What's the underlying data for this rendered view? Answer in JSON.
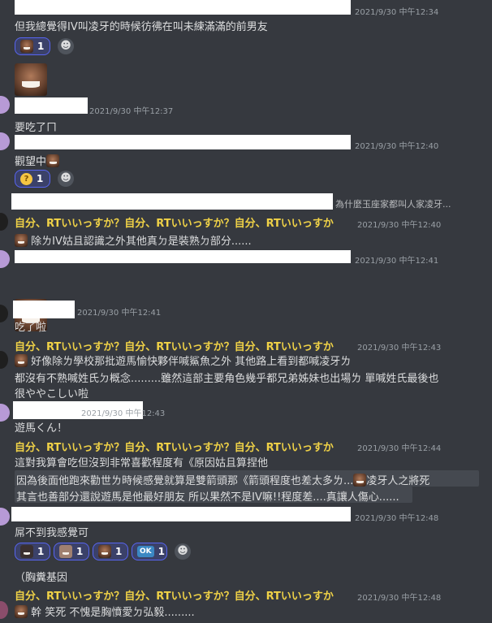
{
  "messages": {
    "m1": {
      "timestamp": "2021/9/30 中午12:34",
      "text": "但我總覺得IV叫凌牙的時候彷彿在叫未練滿滿的前男友",
      "reaction_count": "1"
    },
    "m2": {
      "timestamp": "2021/9/30 中午12:37",
      "text": "要吃了ㄇ"
    },
    "m3": {
      "timestamp": "2021/9/30 中午12:40",
      "text": "觀望中",
      "reaction_count": "1"
    },
    "reply1": {
      "reply_preview": "為什麼玉座家都叫人家凌牙...",
      "author": "自分、RTいいっすか？自分、RTいいっすか？自分、RTいいっすか",
      "timestamp": "2021/9/30 中午12:40",
      "text": "除ㄌIV姑且認識之外其他真ㄉ是裝熟ㄉ部分......"
    },
    "m5": {
      "timestamp": "2021/9/30 中午12:41"
    },
    "m6": {
      "timestamp": "2021/9/30 中午12:41",
      "text": "吃了啦"
    },
    "reply2": {
      "author": "自分、RTいいっすか？自分、RTいいっすか？自分、RTいいっすか",
      "timestamp": "2021/9/30 中午12:43",
      "line1": "好像除ㄌ學校那批遊馬愉快夥伴喊鯊魚之外 其他路上看到都喊凌牙ㄌ",
      "line2": "都沒有不熟喊姓氏ㄉ概念.........雖然這部主要角色幾乎都兄弟姊妹也出場ㄌ 單喊姓氏最後也",
      "line3": "很ややこしい啦"
    },
    "m8": {
      "timestamp": "2021/9/30 中午12:43",
      "text": "遊馬くん！"
    },
    "reply3": {
      "author": "自分、RTいいっすか？自分、RTいいっすか？自分、RTいいっすか",
      "timestamp": "2021/9/30 中午12:44",
      "line1": "這對我算會吃但沒到非常喜歡程度有《原因姑且算捏他",
      "spoiler1a": "因為後面他跑來勸世ㄌ時候感覺就算是雙箭頭那《箭頭程度也差太多ㄌ...",
      "spoiler1b": "凌牙人之將死",
      "spoiler2": "其言也善部分還說遊馬是他最好朋友 所以果然不是IV嘛!!程度差....真讓人傷心......"
    },
    "m10": {
      "timestamp": "2021/9/30 中午12:48",
      "text": "屌不到我感覺可",
      "reactions": [
        "1",
        "1",
        "1",
        "1"
      ],
      "ok_label": "OK"
    },
    "m11": {
      "text": "（胸糞基因"
    },
    "reply4": {
      "author": "自分、RTいいっすか？自分、RTいいっすか？自分、RTいいっすか",
      "timestamp": "2021/9/30 中午12:48",
      "text": "幹 笑死 不愧是胸憤愛ㄉ弘毅........."
    }
  },
  "icons": {
    "add_reaction": "smiley-plus-icon",
    "thinking": "thinking-face-emoji",
    "ok": "ok-button-emoji"
  },
  "colors": {
    "background": "#36393f",
    "text": "#dcddde",
    "timestamp": "#9aa0a6",
    "author_gold": "#f0d247",
    "reaction_active": "#3b4169",
    "reaction_border": "#5865f2",
    "spoiler_bg": "#454950"
  }
}
